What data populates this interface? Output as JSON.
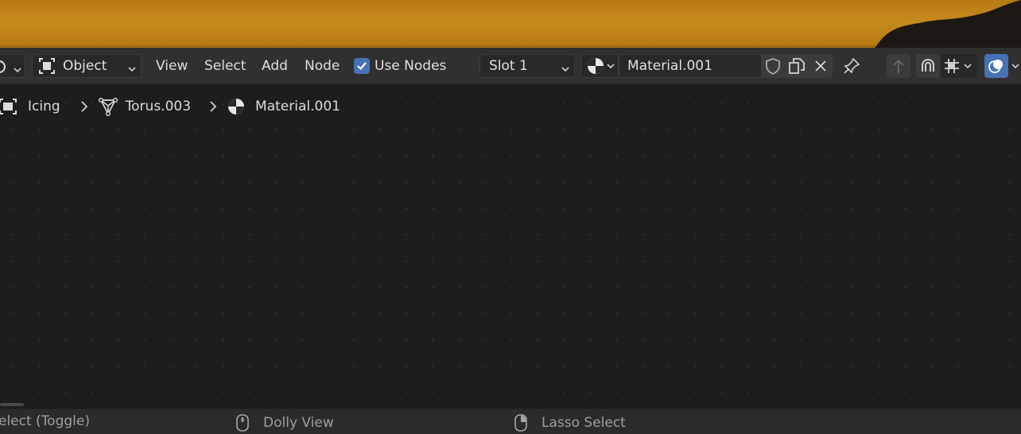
{
  "header": {
    "editor_mode": "Object",
    "menus": [
      "View",
      "Select",
      "Add",
      "Node"
    ],
    "use_nodes_label": "Use Nodes",
    "use_nodes_checked": true,
    "slot": "Slot 1",
    "material_name": "Material.001",
    "icons": [
      "editor-type-icon",
      "object-mode-icon",
      "material-browse-icon",
      "fake-user-shield-icon",
      "duplicate-icon",
      "close-icon",
      "pin-icon",
      "parent-node-tree-icon",
      "snap-icon",
      "snap-increment-icon",
      "overlay-icon"
    ]
  },
  "breadcrumb": {
    "items": [
      {
        "label": "Icing",
        "icon": "object-icon"
      },
      {
        "label": "Torus.003",
        "icon": "mesh-data-icon"
      },
      {
        "label": "Material.001",
        "icon": "material-icon"
      }
    ]
  },
  "statusbar": {
    "hints": [
      {
        "label": "elect (Toggle)",
        "icon": ""
      },
      {
        "label": "Dolly View",
        "icon": "mouse-middle-icon"
      },
      {
        "label": "Lasso Select",
        "icon": "mouse-right-icon"
      }
    ]
  },
  "colors": {
    "accent": "#4772b3",
    "header_bg": "#303030",
    "editor_bg": "#1d1d1d",
    "viewport_orange": "#c58a1c"
  }
}
